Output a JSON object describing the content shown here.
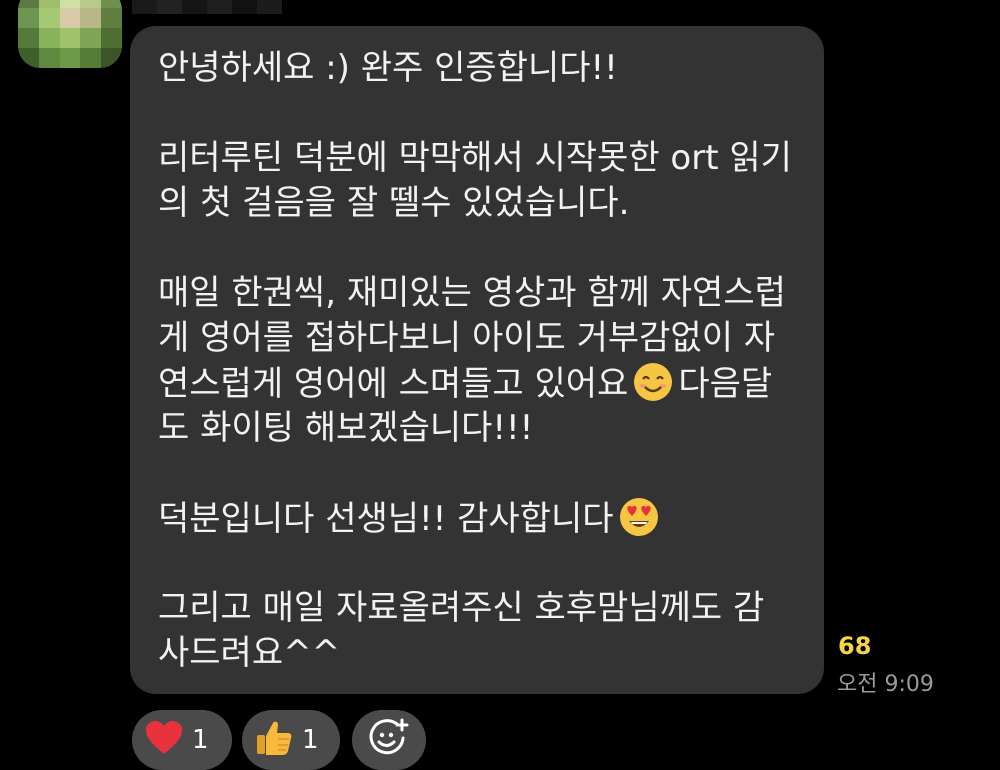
{
  "message": {
    "lines": [
      "안녕하세요 :) 완주 인증합니다!!",
      "",
      "리터루틴 덕분에 막막해서 시작못한 ort 읽기",
      "의 첫 걸음을 잘 뗄수 있었습니다.",
      "",
      "매일 한권씩, 재미있는 영상과 함께 자연스럽",
      "게 영어를 접하다보니 아이도 거부감없이 자",
      "연스럽게 영어에 스며들고 있어요",
      "다음달",
      "도 화이팅 해보겠습니다!!!",
      "",
      "덕분입니다 선생님!! 감사합니다",
      "",
      "그리고 매일 자료올려주신 호후맘님께도 감",
      "사드려요^^"
    ],
    "emojis": {
      "smile": "smiling-face-icon",
      "heart_eyes": "heart-eyes-face-icon"
    }
  },
  "meta": {
    "unread_count": "68",
    "time": "오전 9:09"
  },
  "reactions": [
    {
      "icon": "heart-icon",
      "count": "1",
      "color": "#e8323c"
    },
    {
      "icon": "thumbs-up-icon",
      "count": "1",
      "color": "#f6b93b"
    },
    {
      "icon": "add-reaction-icon",
      "count": ""
    }
  ],
  "colors": {
    "background": "#000000",
    "bubble": "#333333",
    "message_text": "#f2f2f2",
    "unread_count": "#f5d547",
    "timestamp": "#9a9a9a",
    "reaction_chip": "#4a4a4a"
  }
}
